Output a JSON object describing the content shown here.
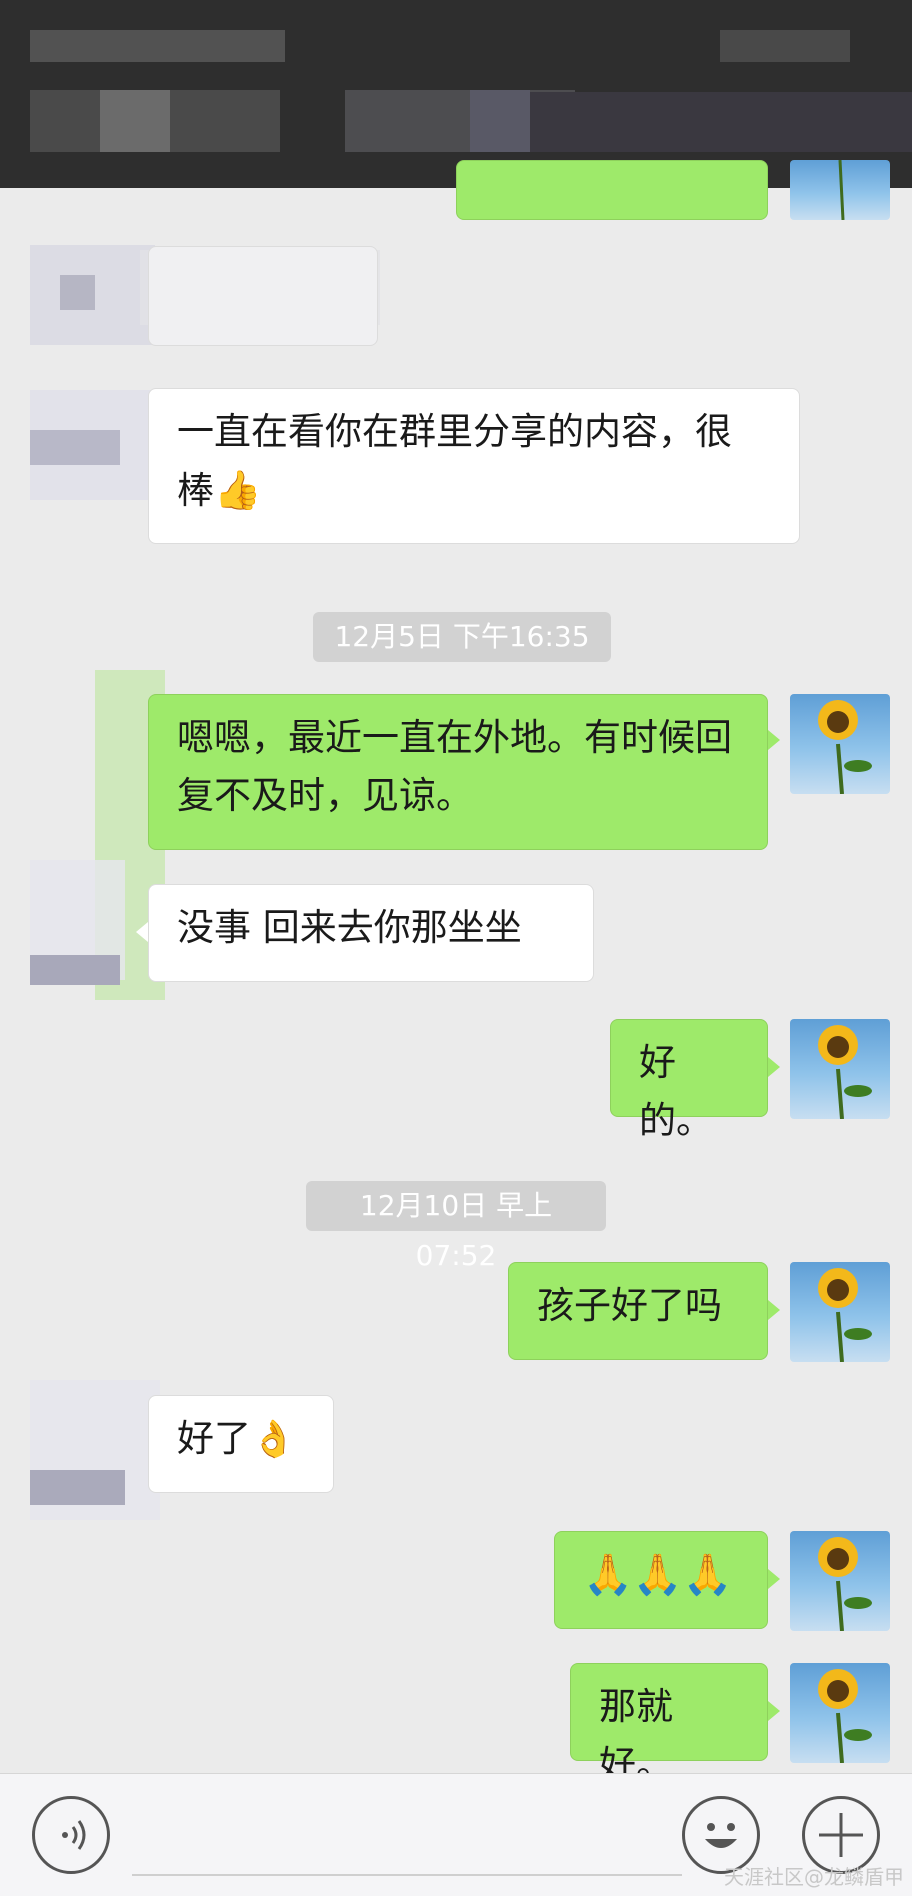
{
  "messages": {
    "m1": "一直在看你在群里分享的内容，很",
    "m1b": "棒",
    "m2": "嗯嗯，最近一直在外地。有时候回",
    "m2b": "复不及时，见谅。",
    "m3": "没事  回来去你那坐坐",
    "m4": "好的。",
    "m5": "孩子好了吗",
    "m6": "好了",
    "m7": "🙏🙏🙏",
    "m8": "那就好。"
  },
  "timestamps": {
    "t1": "12月5日 下午16:35",
    "t2": "12月10日 早上07:52"
  },
  "watermark": "天涯社区@龙鳞盾甲",
  "icons": {
    "voice": "voice-icon",
    "emoji": "emoji-icon",
    "plus": "plus-icon",
    "thumbs": "thumbs-up-icon",
    "ok_hand": "ok-hand-icon"
  },
  "colors": {
    "outgoing_bubble": "#9eea6a",
    "incoming_bubble": "#ffffff",
    "background": "#ebebeb",
    "timestamp_bg": "#d2d2d2"
  }
}
